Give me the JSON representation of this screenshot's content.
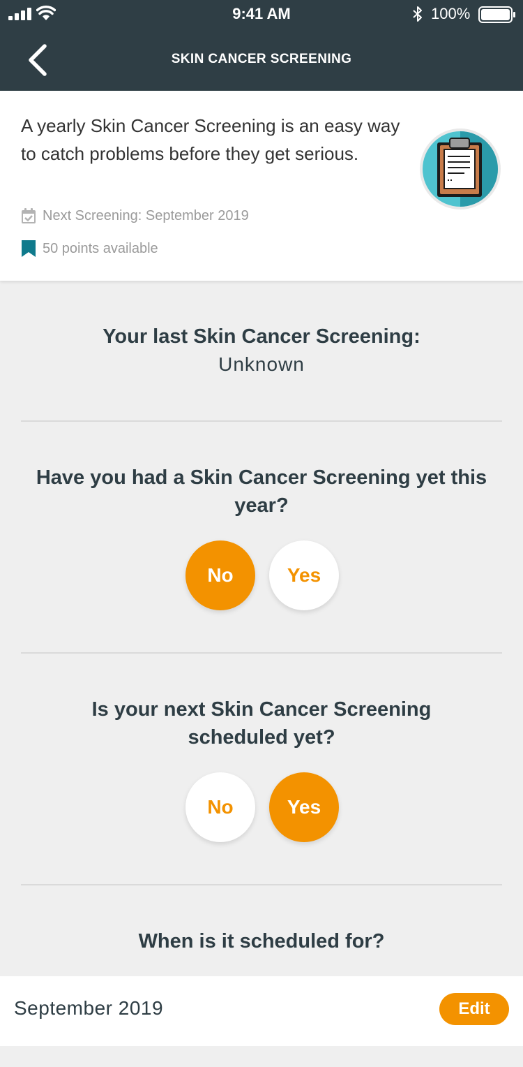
{
  "status_bar": {
    "time": "9:41 AM",
    "battery": "100%",
    "icons": [
      "signal-icon",
      "wifi-icon",
      "bluetooth-icon",
      "battery-icon"
    ]
  },
  "nav": {
    "title": "SKIN CANCER SCREENING",
    "back_icon": "chevron-left-icon"
  },
  "intro": {
    "description": "A yearly Skin Cancer Screening is an easy way to catch problems before they get serious.",
    "next_screening": "Next Screening: September 2019",
    "points": "50 points available",
    "icon": "clipboard-icon"
  },
  "last_screening": {
    "label": "Your last Skin Cancer Screening:",
    "value": "Unknown"
  },
  "question_had": {
    "text": "Have you had a Skin Cancer Screening yet this year?",
    "no_label": "No",
    "yes_label": "Yes",
    "selected": "No"
  },
  "question_scheduled": {
    "text": "Is your next Skin Cancer Screening scheduled yet?",
    "no_label": "No",
    "yes_label": "Yes",
    "selected": "Yes"
  },
  "question_when": {
    "text": "When is it scheduled for?"
  },
  "scheduled_date": {
    "value": "September 2019",
    "edit_label": "Edit"
  },
  "colors": {
    "header_bg": "#2f3e45",
    "accent": "#f39200",
    "icon_teal": "#0f7a8c",
    "icon_circle": "#4fc3cf",
    "page_bg": "#efefef"
  }
}
